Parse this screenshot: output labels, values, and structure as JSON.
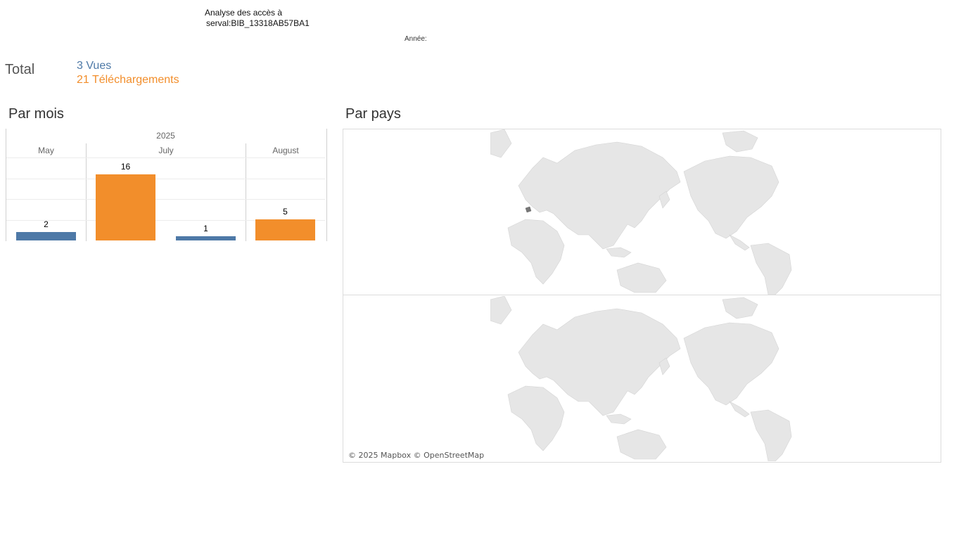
{
  "header": {
    "title_line1": "Analyse des accès à",
    "title_line2": "serval:BIB_13318AB57BA1",
    "year_filter_label": "Année:"
  },
  "totals": {
    "label": "Total",
    "views": "3 Vues",
    "downloads": "21 Téléchargements"
  },
  "sections": {
    "by_month": "Par mois",
    "by_country": "Par pays"
  },
  "chart_data": {
    "type": "bar",
    "title": "Par mois",
    "year": "2025",
    "categories": [
      "May",
      "July",
      "August"
    ],
    "series": [
      {
        "name": "Vues",
        "color": "#4e79a7",
        "values": [
          2,
          1,
          null
        ]
      },
      {
        "name": "Téléchargements",
        "color": "#f28e2b",
        "values": [
          null,
          16,
          5
        ]
      }
    ],
    "ylim": [
      0,
      20
    ],
    "bar_labels": [
      "2",
      "16",
      "1",
      "5"
    ]
  },
  "map": {
    "attribution": "© 2025 Mapbox © OpenStreetMap",
    "land_color": "#e6e6e6",
    "highlight_color": "#777777"
  },
  "colors": {
    "views": "#4e79a7",
    "downloads": "#f28e2b"
  }
}
